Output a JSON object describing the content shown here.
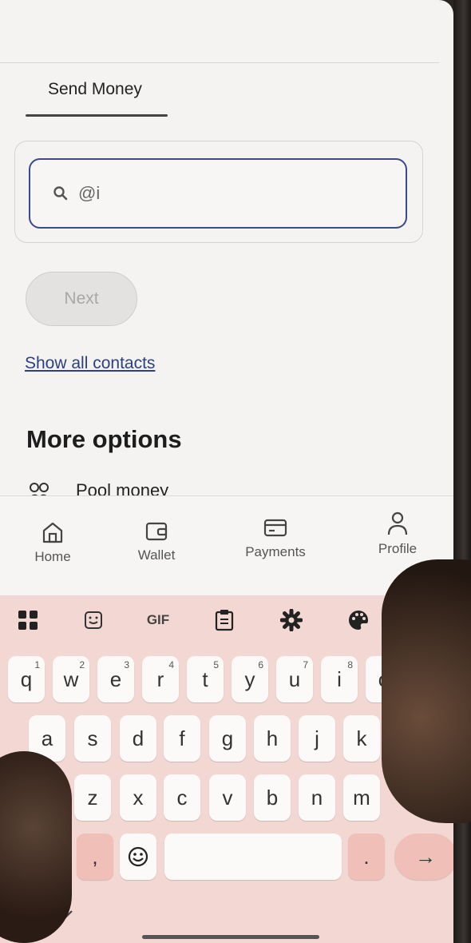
{
  "header": {
    "active_tab": "Send Money"
  },
  "search": {
    "value": "@i"
  },
  "actions": {
    "next_label": "Next",
    "show_all_contacts": "Show all contacts"
  },
  "more_options": {
    "title": "More options",
    "items": [
      {
        "label": "Pool money",
        "icon": "group-icon"
      }
    ]
  },
  "bottom_nav": {
    "items": [
      {
        "label": "Home",
        "icon": "home-icon"
      },
      {
        "label": "Wallet",
        "icon": "wallet-icon"
      },
      {
        "label": "Payments",
        "icon": "card-icon"
      },
      {
        "label": "Profile",
        "icon": "person-icon"
      }
    ]
  },
  "keyboard": {
    "toolbar": [
      "apps-grid-icon",
      "sticker-icon",
      "GIF",
      "clipboard-icon",
      "gear-icon",
      "palette-icon"
    ],
    "gif_label": "GIF",
    "row1": [
      {
        "k": "q",
        "h": "1"
      },
      {
        "k": "w",
        "h": "2"
      },
      {
        "k": "e",
        "h": "3"
      },
      {
        "k": "r",
        "h": "4"
      },
      {
        "k": "t",
        "h": "5"
      },
      {
        "k": "y",
        "h": "6"
      },
      {
        "k": "u",
        "h": "7"
      },
      {
        "k": "i",
        "h": "8"
      },
      {
        "k": "o",
        "h": "9"
      }
    ],
    "row2": [
      "a",
      "s",
      "d",
      "f",
      "g",
      "h",
      "j",
      "k"
    ],
    "row3": [
      "z",
      "x",
      "c",
      "v",
      "b",
      "n",
      "m"
    ],
    "comma": ",",
    "period": ".",
    "enter_symbol": "→",
    "colors": {
      "background": "#f3d7d3",
      "accent_key": "#f0bfb7"
    }
  },
  "colors": {
    "accent": "#3a4b8c",
    "link": "#2b3f86"
  }
}
